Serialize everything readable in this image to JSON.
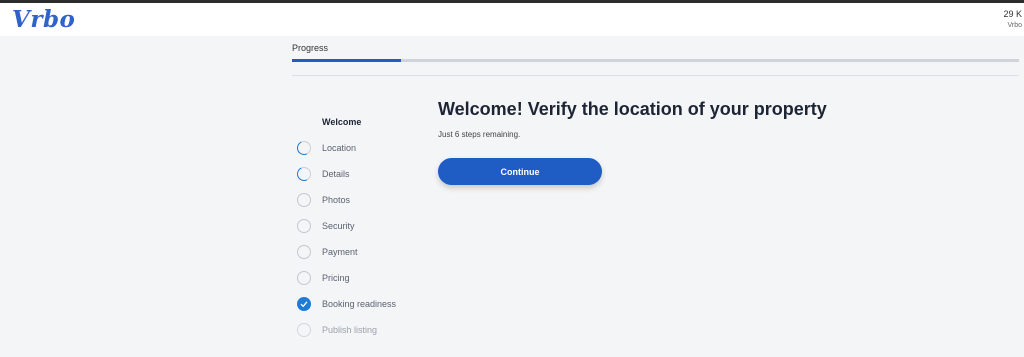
{
  "header": {
    "logo": "Vrbo",
    "right_line1": "29 K",
    "right_line2": "Vrbo"
  },
  "progress": {
    "label": "Progress",
    "fraction": 0.15,
    "accent": "#1f5cc4"
  },
  "steps": [
    {
      "label": "Welcome",
      "state": "current"
    },
    {
      "label": "Location",
      "state": "in-progress"
    },
    {
      "label": "Details",
      "state": "in-progress"
    },
    {
      "label": "Photos",
      "state": "not-started"
    },
    {
      "label": "Security",
      "state": "not-started"
    },
    {
      "label": "Payment",
      "state": "not-started"
    },
    {
      "label": "Pricing",
      "state": "not-started"
    },
    {
      "label": "Booking readiness",
      "state": "complete"
    },
    {
      "label": "Publish listing",
      "state": "locked"
    }
  ],
  "main": {
    "title": "Welcome! Verify the location of your property",
    "subtitle": "Just 6 steps remaining.",
    "continue_label": "Continue"
  }
}
